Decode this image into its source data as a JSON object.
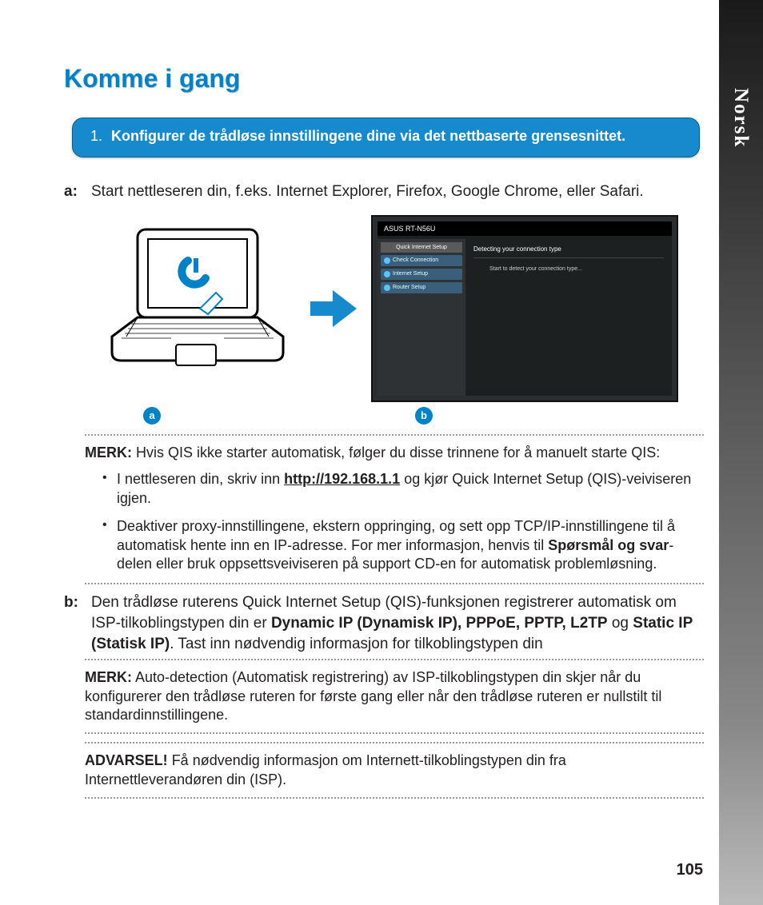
{
  "side_label": "Norsk",
  "heading": "Komme i gang",
  "callout": {
    "num": "1.",
    "text": "Konfigurer de trådløse innstillingene dine via det nettbaserte grensesnittet."
  },
  "step_a": {
    "label": "a:",
    "text": "Start nettleseren din, f.eks. Internet Explorer, Firefox, Google Chrome, eller Safari."
  },
  "router_ui": {
    "brand": "ASUS  RT-N56U",
    "sidebar_header": "Quick Internet Setup",
    "items": [
      "Check Connection",
      "Internet Setup",
      "Router Setup"
    ],
    "main_header": "Detecting your connection type",
    "main_detect": "Start to detect your connection type..."
  },
  "badge_a": "a",
  "badge_b": "b",
  "note1": {
    "label": "MERK:",
    "text": "Hvis QIS ikke starter automatisk, følger du disse trinnene for å manuelt starte QIS:"
  },
  "bullets": [
    {
      "pre": "I nettleseren din, skriv inn ",
      "link": "http://192.168.1.1",
      "post": " og kjør Quick Internet Setup (QIS)-veiviseren igjen."
    },
    {
      "pre": "Deaktiver proxy-innstillingene, ekstern oppringing, og sett opp TCP/IP-innstillingene til å automatisk hente inn en IP-adresse. For mer informasjon, henvis til ",
      "bold": "Spørsmål og svar",
      "post": "-delen eller bruk oppsettsveiviseren på support CD-en for automatisk problemløsning."
    }
  ],
  "step_b": {
    "label": "b:",
    "pre": "Den trådløse ruterens Quick Internet Setup (QIS)-funksjonen registrerer automatisk om ISP-tilkoblingstypen din er ",
    "bold1": "Dynamic IP (Dynamisk IP), PPPoE, PPTP, L2TP",
    "mid": " og ",
    "bold2": "Static IP (Statisk IP)",
    "post": ". Tast inn nødvendig informasjon for tilkoblingstypen din"
  },
  "note2": {
    "label": "MERK:",
    "text": "Auto-detection (Automatisk registrering) av ISP-tilkoblingstypen din skjer når du konfigurerer den trådløse ruteren for første gang eller når den trådløse ruteren er nullstilt til standardinnstillingene."
  },
  "warning": {
    "label": "ADVARSEL!",
    "text": "Få nødvendig informasjon om Internett-tilkoblingstypen din fra Internettleverandøren din (ISP)."
  },
  "page_number": "105"
}
